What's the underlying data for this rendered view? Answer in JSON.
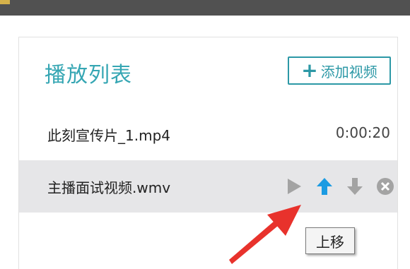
{
  "playlist": {
    "title": "播放列表",
    "add_button_label": "添加视频",
    "items": [
      {
        "name": "此刻宣传片_1.mp4",
        "duration": "0:00:20"
      },
      {
        "name": "主播面试视频.wmv"
      }
    ]
  },
  "row_actions": [
    "play-icon",
    "move-up-icon",
    "move-down-icon",
    "remove-icon"
  ],
  "tooltip": {
    "text": "上移"
  },
  "colors": {
    "accent": "#35a6b3",
    "active_icon": "#1b9be2",
    "inactive_icon": "#a3a3a3",
    "annotation_arrow": "#e8322c"
  }
}
